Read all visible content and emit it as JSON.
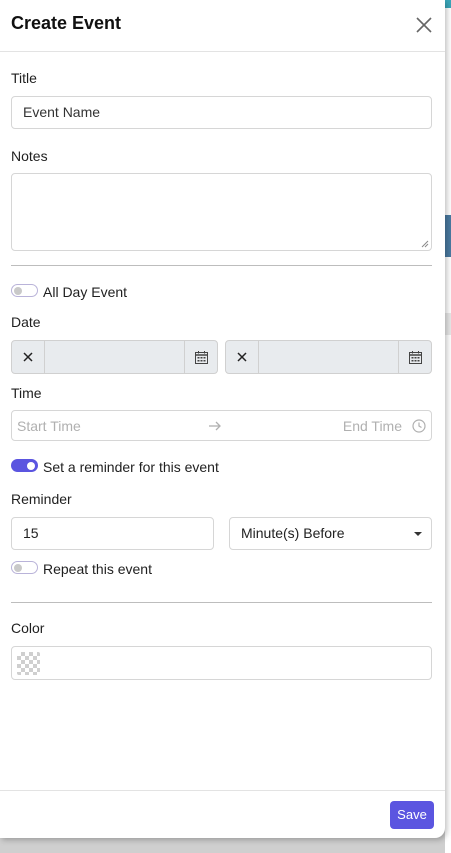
{
  "modal": {
    "title": "Create Event",
    "save_label": "Save"
  },
  "fields": {
    "title_label": "Title",
    "title_value": "Event Name",
    "notes_label": "Notes",
    "notes_value": "",
    "all_day_label": "All Day Event",
    "all_day_on": false,
    "date_label": "Date",
    "start_date": "",
    "end_date": "",
    "time_label": "Time",
    "start_time_placeholder": "Start Time",
    "end_time_placeholder": "End Time",
    "reminder_toggle_label": "Set a reminder for this event",
    "reminder_on": true,
    "reminder_label": "Reminder",
    "reminder_value": "15",
    "reminder_unit": "Minute(s) Before",
    "repeat_label": "Repeat this event",
    "repeat_on": false,
    "color_label": "Color",
    "color_value": "transparent"
  },
  "icons": [
    "close-icon",
    "clear-icon",
    "calendar-icon",
    "arrow-right-icon",
    "clock-icon",
    "caret-down-icon"
  ],
  "colors": {
    "accent": "#5b55e0",
    "date_background": "#e8ebee"
  }
}
